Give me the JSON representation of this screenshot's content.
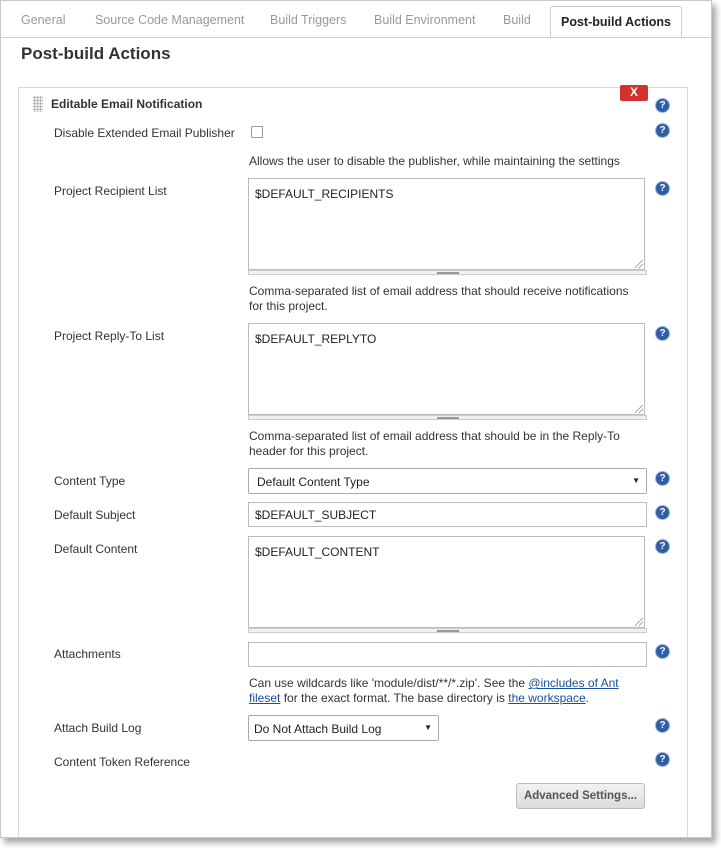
{
  "tabs": [
    {
      "label": "General"
    },
    {
      "label": "Source Code Management"
    },
    {
      "label": "Build Triggers"
    },
    {
      "label": "Build Environment"
    },
    {
      "label": "Build"
    },
    {
      "label": "Post-build Actions"
    }
  ],
  "page_title": "Post-build Actions",
  "section": {
    "title": "Editable Email Notification",
    "delete_label": "X"
  },
  "help_glyph": "?",
  "fields": {
    "disable_publisher": {
      "label": "Disable Extended Email Publisher",
      "checked": false,
      "description": "Allows the user to disable the publisher, while maintaining the settings"
    },
    "recipient_list": {
      "label": "Project Recipient List",
      "value": "$DEFAULT_RECIPIENTS",
      "description": "Comma-separated list of email address that should receive notifications for this project."
    },
    "reply_to_list": {
      "label": "Project Reply-To List",
      "value": "$DEFAULT_REPLYTO",
      "description": "Comma-separated list of email address that should be in the Reply-To header for this project."
    },
    "content_type": {
      "label": "Content Type",
      "selected": "Default Content Type"
    },
    "default_subject": {
      "label": "Default Subject",
      "value": "$DEFAULT_SUBJECT"
    },
    "default_content": {
      "label": "Default Content",
      "value": "$DEFAULT_CONTENT"
    },
    "attachments": {
      "label": "Attachments",
      "value": "",
      "description_pre": "Can use wildcards like 'module/dist/**/*.zip'. See the ",
      "link_ant": "@includes of Ant fileset",
      "description_mid": " for the exact format. The base directory is ",
      "link_workspace": "the workspace",
      "description_post": "."
    },
    "attach_build_log": {
      "label": "Attach Build Log",
      "selected": "Do Not Attach Build Log"
    },
    "content_token_reference": {
      "label": "Content Token Reference"
    }
  },
  "advanced_button": "Advanced Settings...",
  "colors": {
    "delete_red": "#d2322d",
    "help_blue": "#2f5ea8",
    "link_blue": "#1a4fa0"
  }
}
